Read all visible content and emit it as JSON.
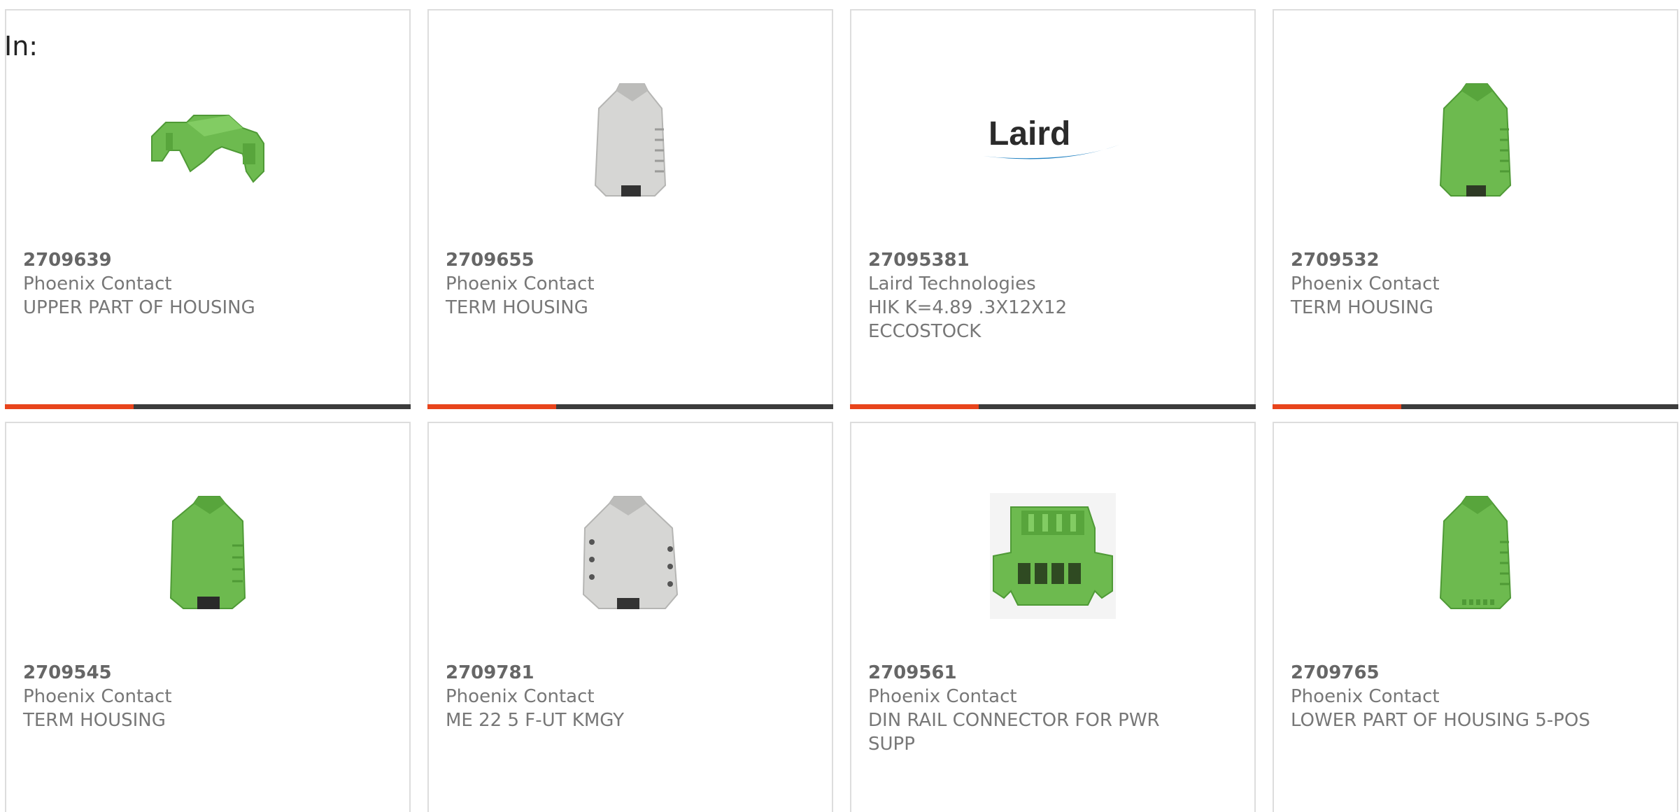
{
  "filter": {
    "label": "In:"
  },
  "colors": {
    "accent_red": "#e8441c",
    "accent_dark": "#3c3c3c",
    "housing_green": "#6dba4f",
    "housing_gray": "#d6d6d4",
    "laird_blue": "#1d7fc1"
  },
  "products": [
    {
      "part_no": "2709639",
      "manufacturer": "Phoenix Contact",
      "description": "UPPER PART OF HOUSING",
      "image": "green-housing-upper-icon"
    },
    {
      "part_no": "2709655",
      "manufacturer": "Phoenix Contact",
      "description": "TERM HOUSING",
      "image": "gray-term-housing-icon"
    },
    {
      "part_no": "27095381",
      "manufacturer": "Laird Technologies",
      "description": "HIK K=4.89 .3X12X12 ECCOSTOCK",
      "image": "laird-logo",
      "logo_text": "Laird"
    },
    {
      "part_no": "2709532",
      "manufacturer": "Phoenix Contact",
      "description": "TERM HOUSING",
      "image": "green-term-housing-icon"
    },
    {
      "part_no": "2709545",
      "manufacturer": "Phoenix Contact",
      "description": "TERM HOUSING",
      "image": "green-term-housing-icon"
    },
    {
      "part_no": "2709781",
      "manufacturer": "Phoenix Contact",
      "description": "ME 22 5 F-UT KMGY",
      "image": "gray-term-housing-icon"
    },
    {
      "part_no": "2709561",
      "manufacturer": "Phoenix Contact",
      "description": "DIN RAIL CONNECTOR FOR PWR SUPP",
      "image": "din-rail-connector-icon"
    },
    {
      "part_no": "2709765",
      "manufacturer": "Phoenix Contact",
      "description": "LOWER PART OF HOUSING 5-POS",
      "image": "green-term-housing-icon"
    }
  ]
}
